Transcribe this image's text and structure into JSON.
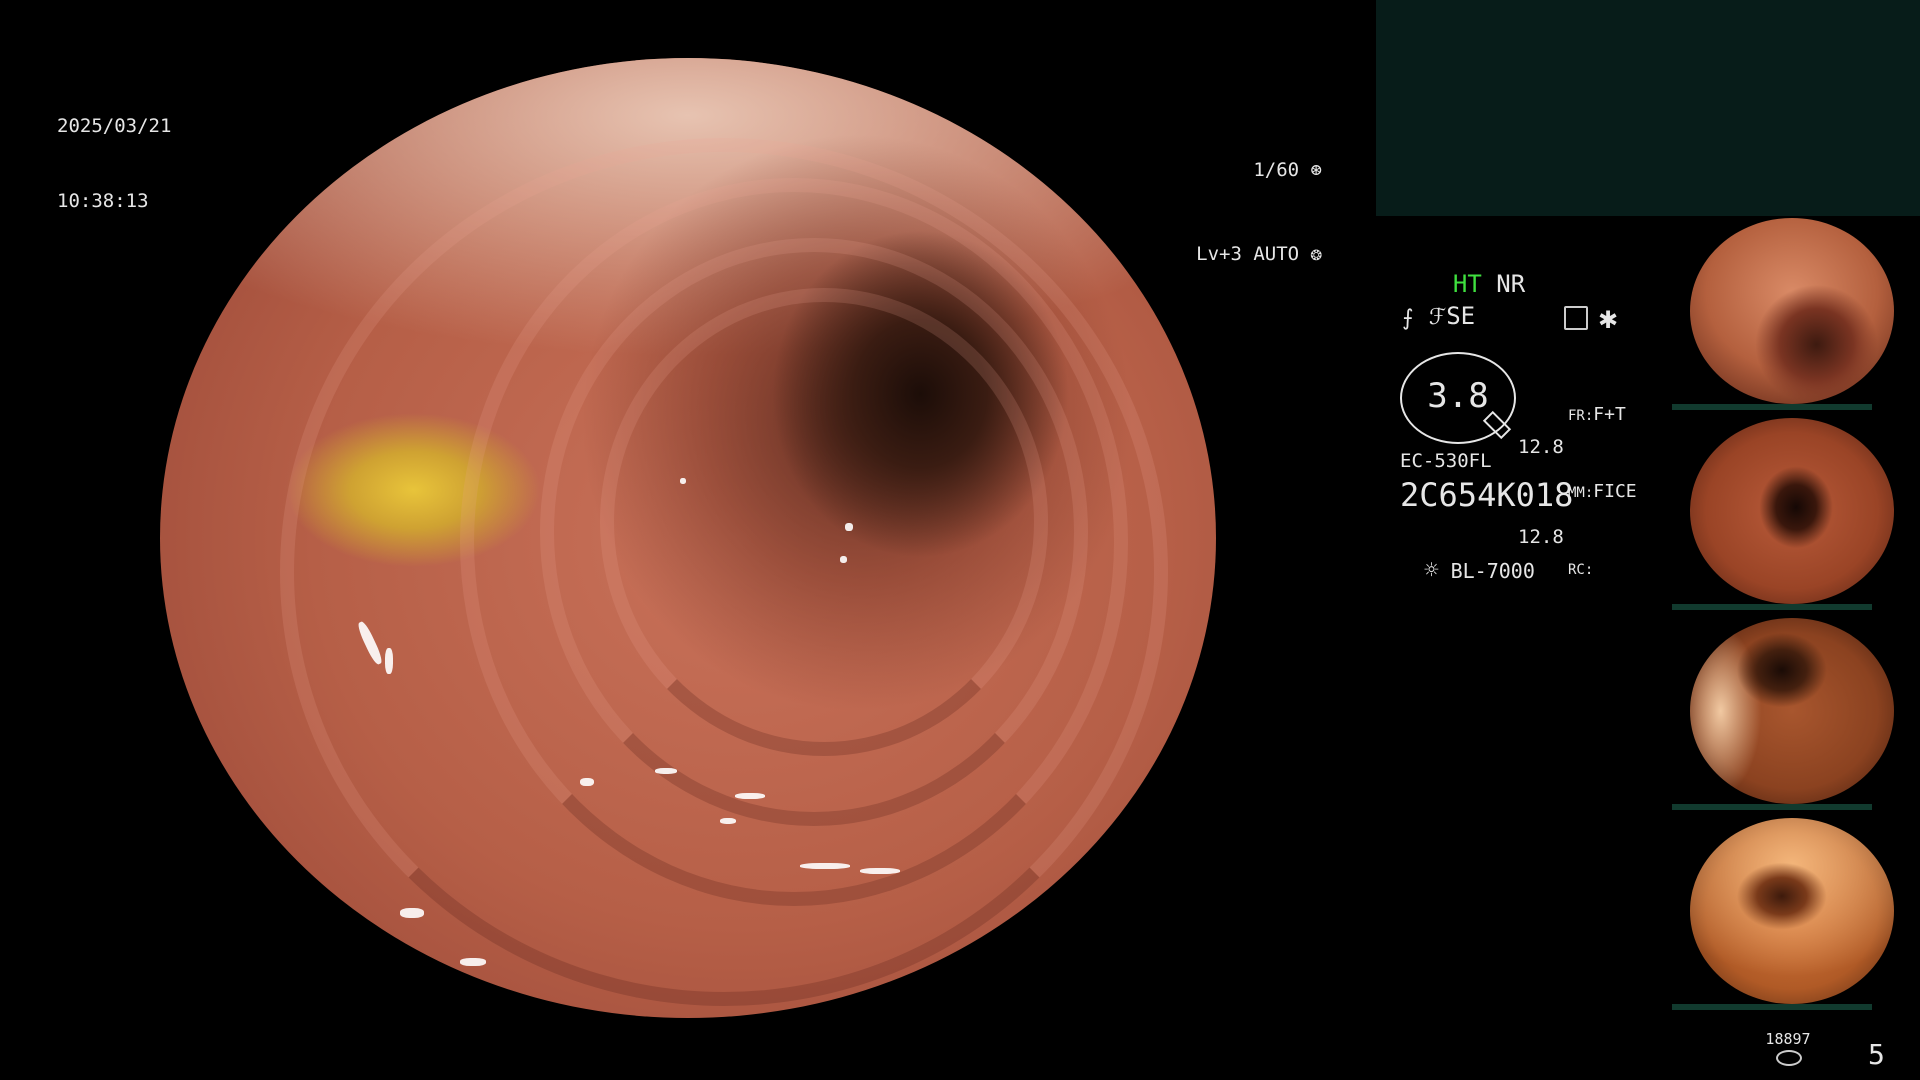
{
  "datetime": {
    "date": "2025/03/21",
    "time": "10:38:13"
  },
  "exposure": {
    "shutter": "1/60",
    "level": "Lv+3",
    "mode": "AUTO"
  },
  "modes": {
    "ht": "HT",
    "nr": "NR",
    "se": "SE"
  },
  "scope": {
    "zoom": "3.8",
    "v1": "12.8",
    "v2": "12.8",
    "fr_label": "FR:",
    "fr_value": "F+T",
    "mm_label": "MM:",
    "mm_value": "FICE",
    "rc_label": "RC:",
    "model": "EC-530FL",
    "serial": "2C654K018",
    "light": "BL-7000"
  },
  "footer": {
    "count": "18897",
    "page": "5"
  },
  "thumbnails": [
    {
      "name": "capture-1"
    },
    {
      "name": "capture-2"
    },
    {
      "name": "capture-3"
    },
    {
      "name": "capture-4"
    }
  ],
  "colors": {
    "panel": "#071c19",
    "accent": "#3fe03f"
  }
}
